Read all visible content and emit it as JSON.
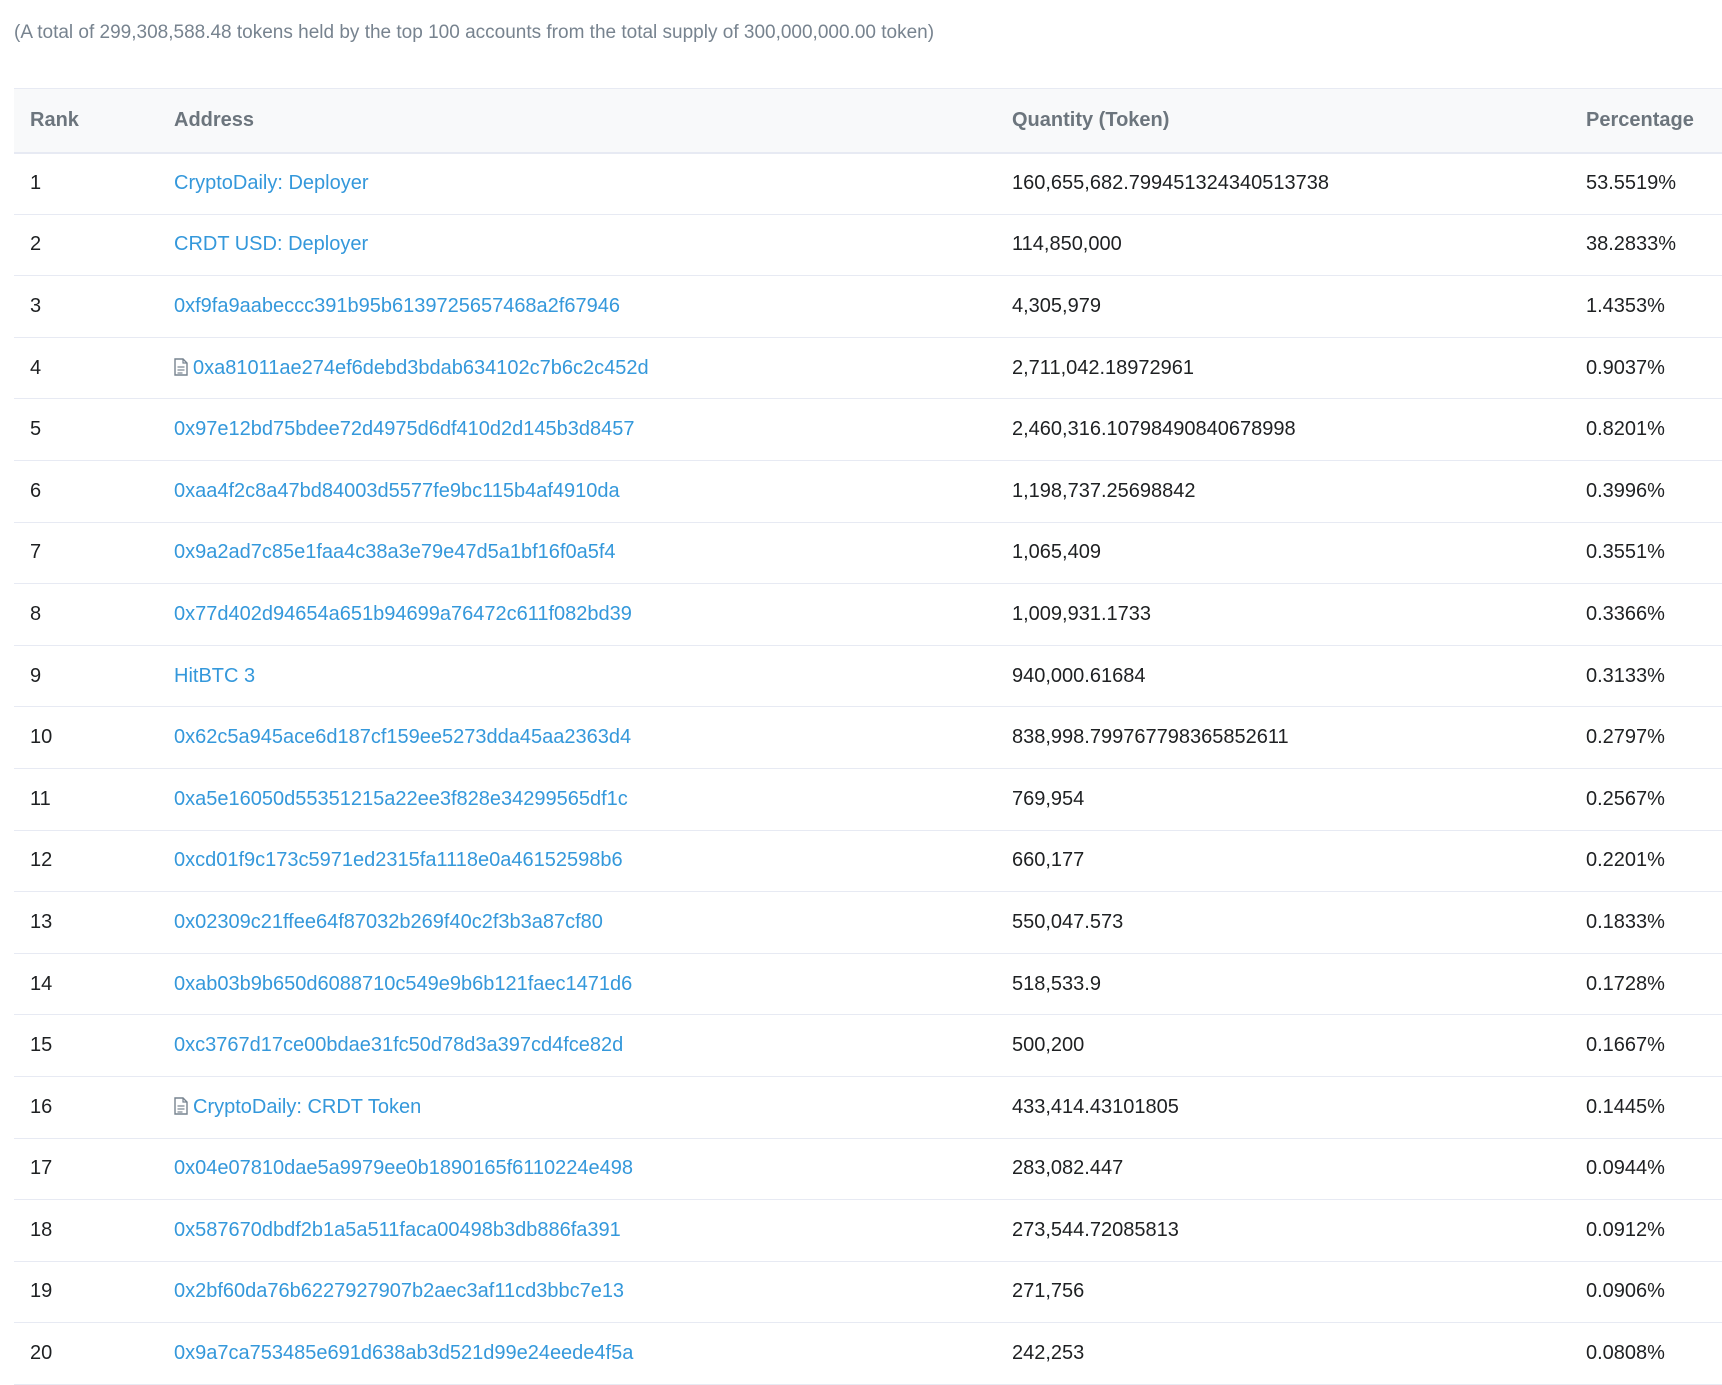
{
  "summary": "(A total of 299,308,588.48 tokens held by the top 100 accounts from the total supply of 300,000,000.00 token)",
  "table": {
    "headers": {
      "rank": "Rank",
      "address": "Address",
      "quantity": "Quantity (Token)",
      "percentage": "Percentage"
    },
    "rows": [
      {
        "rank": "1",
        "address": "CryptoDaily: Deployer",
        "contract": false,
        "quantity": "160,655,682.79945132434051373​8",
        "percentage": "53.5519%"
      },
      {
        "rank": "2",
        "address": "CRDT USD: Deployer",
        "contract": false,
        "quantity": "114,850,000",
        "percentage": "38.2833%"
      },
      {
        "rank": "3",
        "address": "0xf9fa9aabeccc391b95b6139725657468a2f67946",
        "contract": false,
        "quantity": "4,305,979",
        "percentage": "1.4353%"
      },
      {
        "rank": "4",
        "address": "0xa81011ae274ef6debd3bdab634102c7b6c2c452d",
        "contract": true,
        "quantity": "2,711,042.18972961",
        "percentage": "0.9037%"
      },
      {
        "rank": "5",
        "address": "0x97e12bd75bdee72d4975d6df410d2d145b3d8457",
        "contract": false,
        "quantity": "2,460,316.10798490840678998",
        "percentage": "0.8201%"
      },
      {
        "rank": "6",
        "address": "0xaa4f2c8a47bd84003d5577fe9bc115b4af4910da",
        "contract": false,
        "quantity": "1,198,737.25698842",
        "percentage": "0.3996%"
      },
      {
        "rank": "7",
        "address": "0x9a2ad7c85e1faa4c38a3e79e47d5a1bf16f0a5f4",
        "contract": false,
        "quantity": "1,065,409",
        "percentage": "0.3551%"
      },
      {
        "rank": "8",
        "address": "0x77d402d94654a651b94699a76472c611f082bd39",
        "contract": false,
        "quantity": "1,009,931.1733",
        "percentage": "0.3366%"
      },
      {
        "rank": "9",
        "address": "HitBTC 3",
        "contract": false,
        "quantity": "940,000.61684",
        "percentage": "0.3133%"
      },
      {
        "rank": "10",
        "address": "0x62c5a945ace6d187cf159ee5273dda45aa2363d4",
        "contract": false,
        "quantity": "838,998.799767798365852611",
        "percentage": "0.2797%"
      },
      {
        "rank": "11",
        "address": "0xa5e16050d55351215a22ee3f828e34299565df1c",
        "contract": false,
        "quantity": "769,954",
        "percentage": "0.2567%"
      },
      {
        "rank": "12",
        "address": "0xcd01f9c173c5971ed2315fa1118e0a46152598b6",
        "contract": false,
        "quantity": "660,177",
        "percentage": "0.2201%"
      },
      {
        "rank": "13",
        "address": "0x02309c21ffee64f87032b269f40c2f3b3a87cf80",
        "contract": false,
        "quantity": "550,047.573",
        "percentage": "0.1833%"
      },
      {
        "rank": "14",
        "address": "0xab03b9b650d6088710c549e9b6b121faec1471d6",
        "contract": false,
        "quantity": "518,533.9",
        "percentage": "0.1728%"
      },
      {
        "rank": "15",
        "address": "0xc3767d17ce00bdae31fc50d78d3a397cd4fce82d",
        "contract": false,
        "quantity": "500,200",
        "percentage": "0.1667%"
      },
      {
        "rank": "16",
        "address": "CryptoDaily: CRDT Token",
        "contract": true,
        "quantity": "433,414.43101805",
        "percentage": "0.1445%"
      },
      {
        "rank": "17",
        "address": "0x04e07810dae5a9979ee0b1890165f6110224e498",
        "contract": false,
        "quantity": "283,082.447",
        "percentage": "0.0944%"
      },
      {
        "rank": "18",
        "address": "0x587670dbdf2b1a5a511faca00498b3db886fa391",
        "contract": false,
        "quantity": "273,544.72085813",
        "percentage": "0.0912%"
      },
      {
        "rank": "19",
        "address": "0x2bf60da76b6227927907b2aec3af11cd3bbc7e13",
        "contract": false,
        "quantity": "271,756",
        "percentage": "0.0906%"
      },
      {
        "rank": "20",
        "address": "0x9a7ca753485e691d638ab3d521d99e24eede4f5a",
        "contract": false,
        "quantity": "242,253",
        "percentage": "0.0808%"
      }
    ]
  },
  "colors": {
    "link": "#3498db",
    "header_bg": "#f8f9fa",
    "muted_text": "#77838f",
    "border": "#e7eaf3"
  },
  "icons": {
    "contract": "contract-icon"
  }
}
